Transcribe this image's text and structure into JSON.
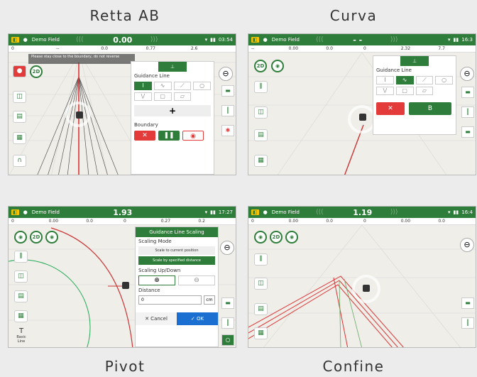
{
  "captions": [
    "Retta AB",
    "Curva",
    "Pivot",
    "Confine"
  ],
  "panels": [
    {
      "field": "Demo Field",
      "speed": "0.00",
      "time": "03:54",
      "info": [
        "0",
        "--",
        "0.0",
        "0.77",
        "2.6"
      ],
      "toast": "Please stay close to the boundary, do not reverse",
      "dialog_title": "Guidance Line",
      "boundary_label": "Boundary",
      "mode_2d": "2D",
      "plus": "+"
    },
    {
      "field": "Demo Field",
      "speed": "- -",
      "time": "16:3",
      "info": [
        "--",
        "0.00",
        "0.0",
        "0",
        "2.32",
        "7.7"
      ],
      "dialog_title": "Guidance Line",
      "b_label": "B",
      "mode_2d": "2D"
    },
    {
      "field": "Demo Field",
      "speed": "1.93",
      "time": "17:27",
      "info": [
        "0",
        "0.00",
        "0.0",
        "0",
        "0.27",
        "0.2"
      ],
      "dialog_title": "Guidance Line Scaling",
      "scaling_mode": "Scaling Mode",
      "scale_current": "Scale to current position",
      "scale_distance": "Scale by specified distance",
      "scaling_updown": "Scaling Up/Down",
      "distance_label": "Distance",
      "distance_value": "0",
      "unit": "cm",
      "cancel": "✕ Cancel",
      "ok": "✓ OK",
      "basic_label": "Basic Line",
      "mode_2d": "2D"
    },
    {
      "field": "Demo Field",
      "speed": "1.19",
      "time": "16:4",
      "info": [
        "0",
        "0.00",
        "0.0",
        "0",
        "0.00",
        "0.0"
      ],
      "mode_2d": "2D"
    }
  ],
  "colors": {
    "brand_green": "#2f7d3a",
    "accent_yellow": "#f5c400",
    "alert_red": "#e33a3a"
  }
}
